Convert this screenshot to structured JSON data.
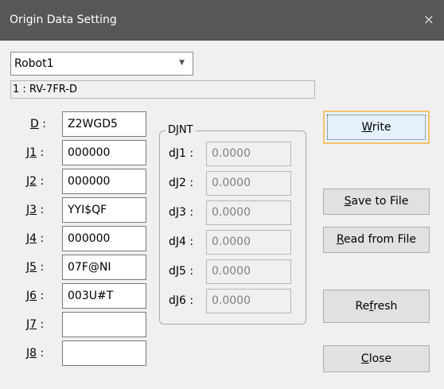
{
  "window": {
    "title": "Origin Data Setting",
    "close_glyph": "×"
  },
  "robot_select": {
    "value": "Robot1"
  },
  "robot_model": "1 : RV-7FR-D",
  "origin_rows": [
    {
      "prefix": "",
      "hotkey": "D",
      "suffix": "",
      "colon": ":",
      "value": "Z2WGD5"
    },
    {
      "prefix": "J",
      "hotkey": "1",
      "suffix": "",
      "colon": ":",
      "value": "000000"
    },
    {
      "prefix": "J",
      "hotkey": "2",
      "suffix": "",
      "colon": ":",
      "value": "000000"
    },
    {
      "prefix": "J",
      "hotkey": "3",
      "suffix": "",
      "colon": ":",
      "value": "YYI$QF"
    },
    {
      "prefix": "J",
      "hotkey": "4",
      "suffix": "",
      "colon": ":",
      "value": "000000"
    },
    {
      "prefix": "J",
      "hotkey": "5",
      "suffix": "",
      "colon": ":",
      "value": "07F@NI"
    },
    {
      "prefix": "J",
      "hotkey": "6",
      "suffix": "",
      "colon": ":",
      "value": "003U#T"
    },
    {
      "prefix": "J",
      "hotkey": "7",
      "suffix": "",
      "colon": ":",
      "value": ""
    },
    {
      "prefix": "J",
      "hotkey": "8",
      "suffix": "",
      "colon": ":",
      "value": ""
    }
  ],
  "djnt": {
    "title_prefix": "D",
    "title_hotkey": "J",
    "title_suffix": "NT",
    "rows": [
      {
        "label": "dJ1 :",
        "value": "0.0000"
      },
      {
        "label": "dJ2 :",
        "value": "0.0000"
      },
      {
        "label": "dJ3 :",
        "value": "0.0000"
      },
      {
        "label": "dJ4 :",
        "value": "0.0000"
      },
      {
        "label": "dJ5 :",
        "value": "0.0000"
      },
      {
        "label": "dJ6 :",
        "value": "0.0000"
      }
    ]
  },
  "buttons": {
    "write": {
      "pre": "",
      "key": "W",
      "post": "rite"
    },
    "save": {
      "pre": "",
      "key": "S",
      "post": "ave to File"
    },
    "read": {
      "pre": "",
      "key": "R",
      "post": "ead from File"
    },
    "refresh": {
      "pre": "Re",
      "key": "f",
      "post": "resh"
    },
    "close": {
      "pre": "",
      "key": "C",
      "post": "lose"
    }
  }
}
